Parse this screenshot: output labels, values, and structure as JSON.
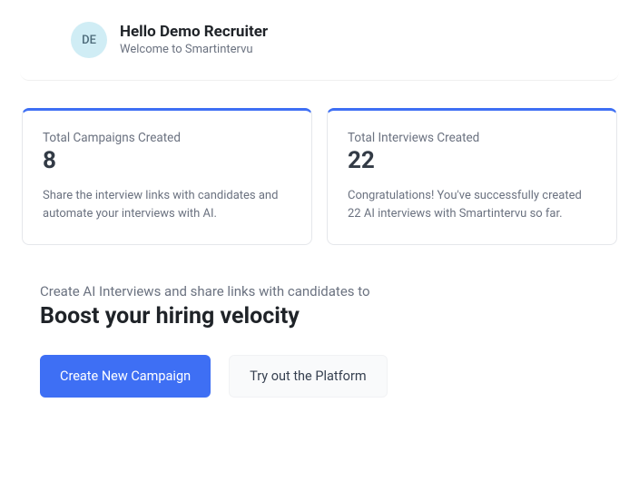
{
  "header": {
    "avatar_initials": "DE",
    "title": "Hello Demo Recruiter",
    "subtitle": "Welcome to Smartintervu"
  },
  "stats": [
    {
      "label": "Total Campaigns Created",
      "value": "8",
      "description": "Share the interview links with candidates and automate your interviews with AI."
    },
    {
      "label": "Total Interviews Created",
      "value": "22",
      "description": "Congratulations! You've successfully created 22 AI interviews with Smartintervu so far."
    }
  ],
  "cta": {
    "pretitle": "Create AI Interviews and share links with candidates to",
    "title": "Boost your hiring velocity",
    "primary_button": "Create New Campaign",
    "secondary_button": "Try out the Platform"
  }
}
